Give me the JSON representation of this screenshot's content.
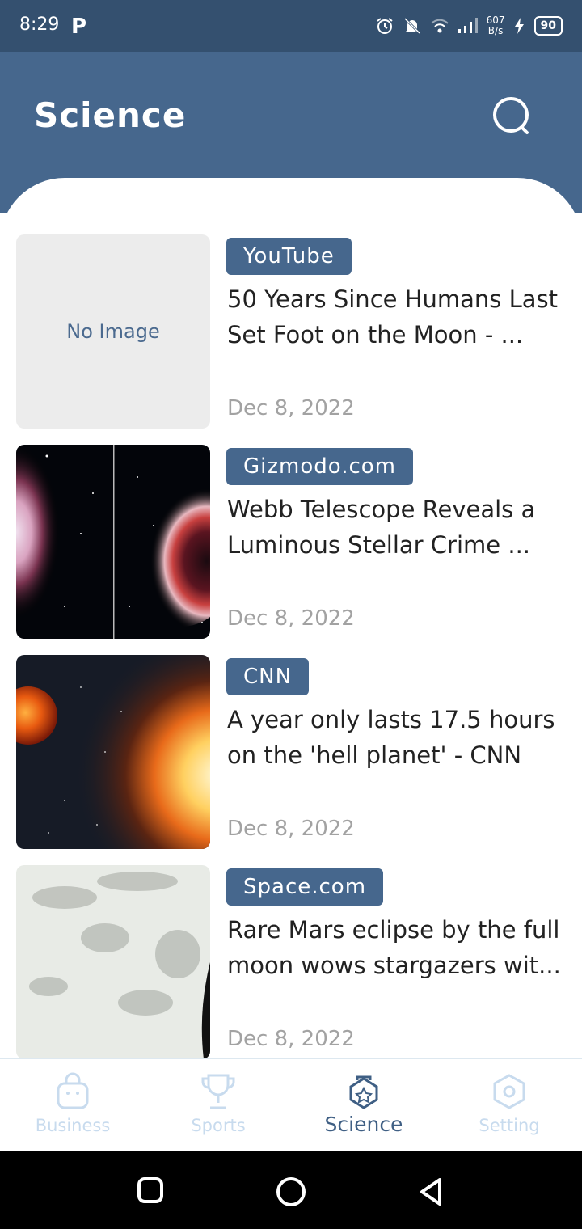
{
  "status_bar": {
    "time": "8:29",
    "app_icon": "P",
    "net_speed_value": "607",
    "net_speed_unit": "B/s",
    "battery": "90",
    "icons": [
      "alarm-icon",
      "mute-icon",
      "wifi-icon",
      "signal-icon",
      "charging-icon",
      "battery-icon"
    ]
  },
  "header": {
    "title": "Science",
    "search_icon": "search-icon"
  },
  "colors": {
    "header": "#46678d",
    "status_bar": "#34506f",
    "accent": "#46678d",
    "inactive_nav": "#c8dbee"
  },
  "articles": [
    {
      "source": "YouTube",
      "title": "50 Years Since Humans Last Set Foot on the Moon - ...",
      "date": "Dec 8, 2022",
      "thumbnail_text": "No Image"
    },
    {
      "source": "Gizmodo.com",
      "title": "Webb Telescope Reveals a Luminous Stellar Crime ...",
      "date": "Dec 8, 2022"
    },
    {
      "source": "CNN",
      "title": "A year only lasts 17.5 hours on the 'hell planet' - CNN",
      "date": "Dec 8, 2022"
    },
    {
      "source": "Space.com",
      "title": "Rare Mars eclipse by the full moon wows stargazers wit...",
      "date": "Dec 8, 2022"
    }
  ],
  "bottom_nav": [
    {
      "label": "Business",
      "icon": "shopping-bag-icon",
      "active": false
    },
    {
      "label": "Sports",
      "icon": "trophy-icon",
      "active": false
    },
    {
      "label": "Science",
      "icon": "science-icon",
      "active": true
    },
    {
      "label": "Setting",
      "icon": "settings-icon",
      "active": false
    }
  ],
  "system_nav": [
    "recents-icon",
    "home-icon",
    "back-icon"
  ]
}
